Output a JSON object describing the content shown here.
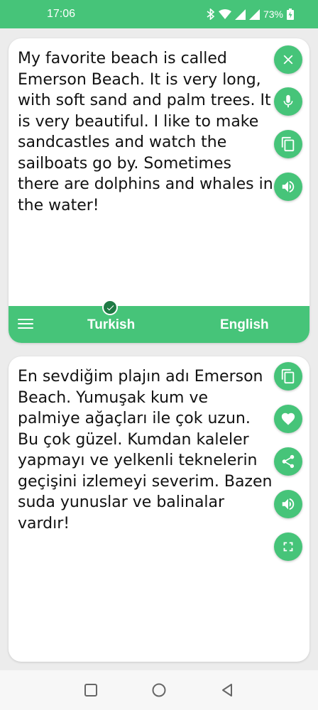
{
  "status_bar": {
    "time": "17:06",
    "battery": "73%",
    "icons": [
      "bluetooth-icon",
      "wifi-icon",
      "signal-icon",
      "signal-icon",
      "battery-icon"
    ]
  },
  "source_card": {
    "text": "My favorite beach is called Emerson Beach. It is very long, with soft sand and palm trees. It is very beautiful. I like to make sandcastles and watch the sailboats go by. Sometimes there are dolphins and whales in the water!",
    "actions": [
      "close-icon",
      "microphone-icon",
      "copy-icon",
      "speaker-icon"
    ]
  },
  "language_bar": {
    "source_language": "Turkish",
    "target_language": "English",
    "menu_icon": "menu-icon",
    "selected_indicator": "check-icon"
  },
  "target_card": {
    "text": "En sevdiğim plajın adı Emerson Beach. Yumuşak kum ve palmiye ağaçları ile çok uzun. Bu çok güzel. Kumdan kaleler yapmayı ve yelkenli teknelerin geçişini izlemeyi severim. Bazen suda yunuslar ve balinalar vardır!",
    "actions": [
      "copy-icon",
      "heart-icon",
      "share-icon",
      "speaker-icon",
      "fullscreen-icon"
    ]
  },
  "colors": {
    "accent": "#46c479",
    "badge": "#1f7a45",
    "background": "#ececec"
  },
  "nav_bar": {
    "buttons": [
      "recent-apps-icon",
      "home-icon",
      "back-icon"
    ]
  }
}
